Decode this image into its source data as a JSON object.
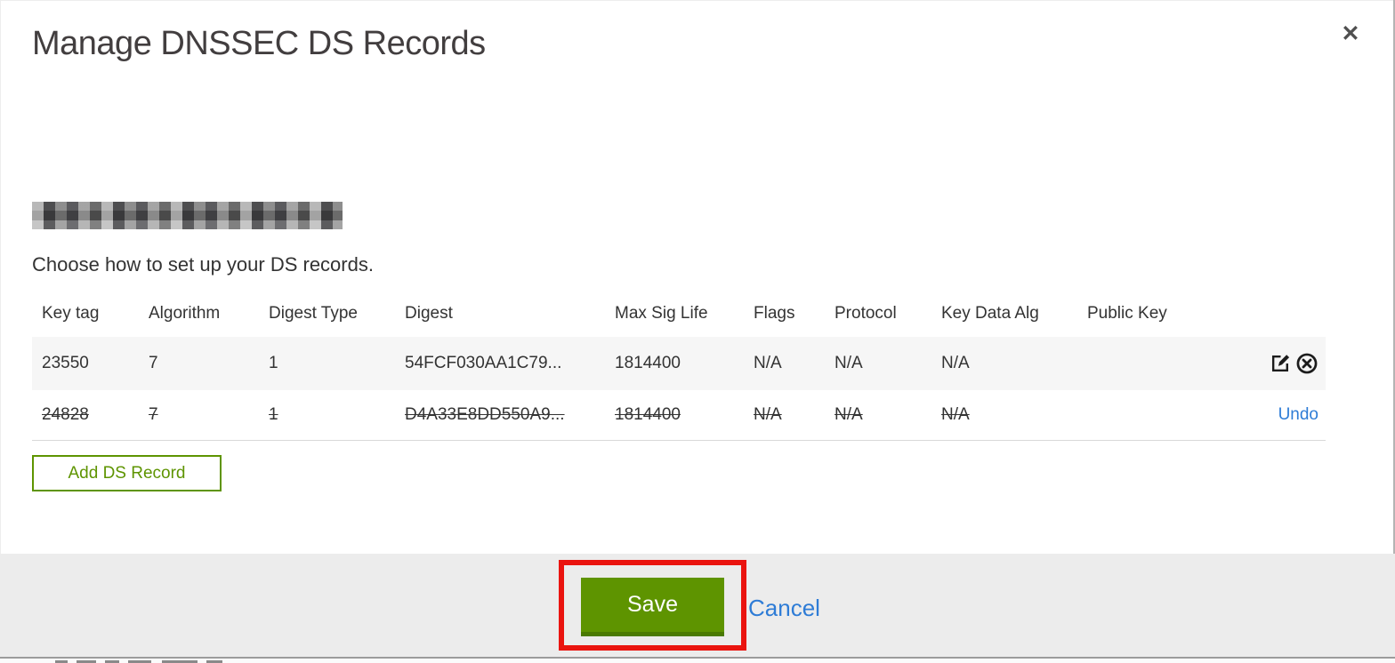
{
  "dialog": {
    "title": "Manage DNSSEC DS Records",
    "intro": "Choose how to set up your DS records.",
    "domain": {
      "redacted": true
    }
  },
  "icons": {
    "close": "✕",
    "edit": "edit-pencil-square",
    "delete": "x-in-circle"
  },
  "table": {
    "headers": [
      "Key tag",
      "Algorithm",
      "Digest Type",
      "Digest",
      "Max Sig Life",
      "Flags",
      "Protocol",
      "Key Data Alg",
      "Public Key"
    ],
    "rows": [
      {
        "key_tag": "23550",
        "algorithm": "7",
        "digest_type": "1",
        "digest": "54FCF030AA1C79...",
        "max_sig_life": "1814400",
        "flags": "N/A",
        "protocol": "N/A",
        "key_data_alg": "N/A",
        "public_key": "",
        "state": "active"
      },
      {
        "key_tag": "24828",
        "algorithm": "7",
        "digest_type": "1",
        "digest": "D4A33E8DD550A9...",
        "max_sig_life": "1814400",
        "flags": "N/A",
        "protocol": "N/A",
        "key_data_alg": "N/A",
        "public_key": "",
        "state": "deleted",
        "undo_label": "Undo"
      }
    ]
  },
  "buttons": {
    "add_ds_record": "Add DS Record",
    "save": "Save",
    "cancel": "Cancel"
  },
  "colors": {
    "accent_green": "#5e9400",
    "accent_green_dark": "#4a7a02",
    "link_blue": "#2e7cd6",
    "annotation_red": "#ea140f",
    "footer_bg": "#ececec",
    "row_alt_bg": "#f6f6f6"
  }
}
